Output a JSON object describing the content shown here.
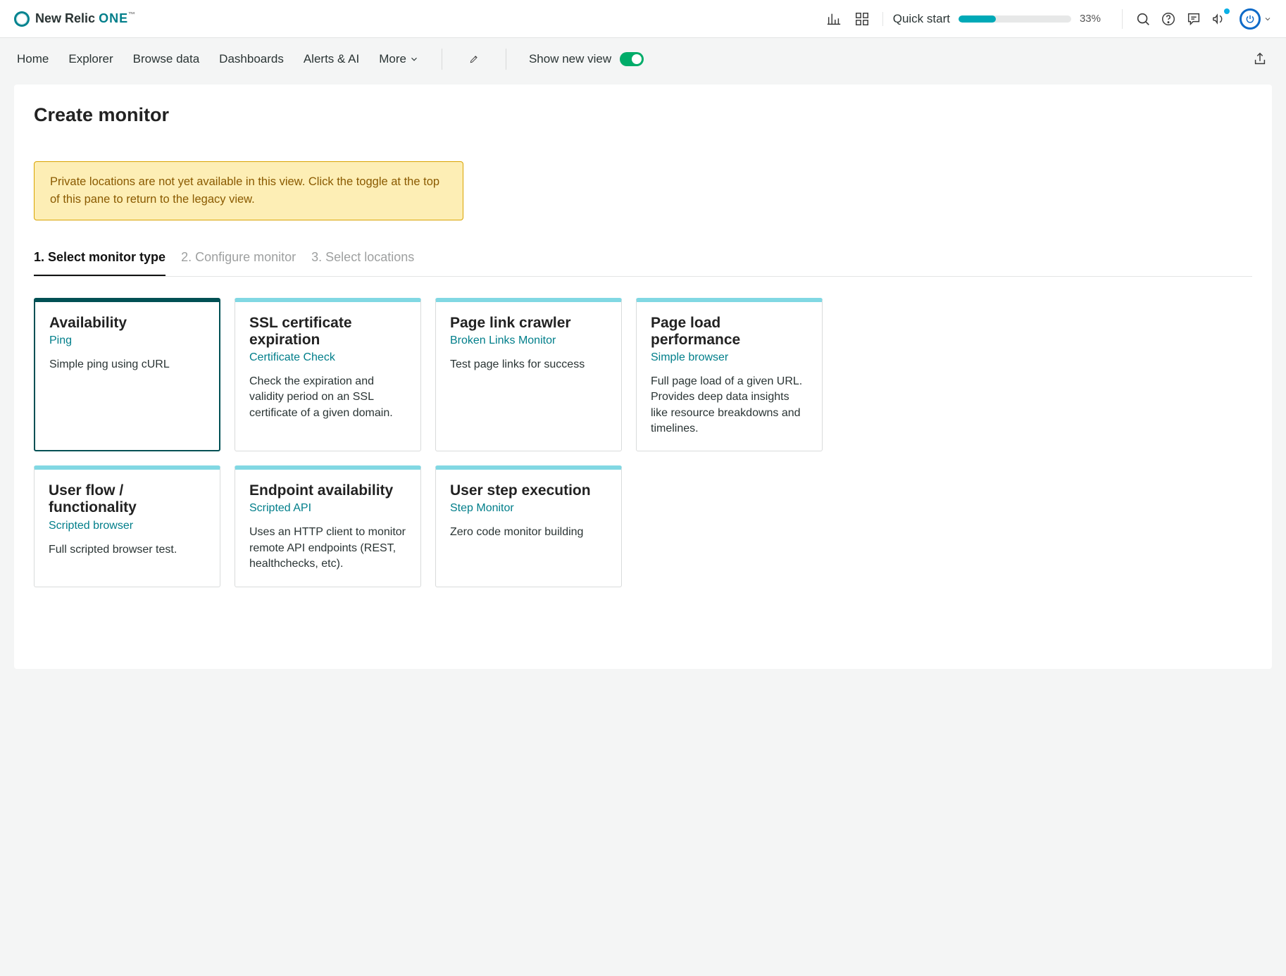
{
  "brand": {
    "name": "New Relic",
    "suffix": "ONE",
    "tm": "™"
  },
  "header": {
    "quick_start_label": "Quick start",
    "progress_percent": "33%"
  },
  "nav": {
    "items": [
      "Home",
      "Explorer",
      "Browse data",
      "Dashboards",
      "Alerts & AI",
      "More"
    ],
    "show_new_view": "Show new view"
  },
  "page": {
    "title": "Create monitor",
    "banner": "Private locations are not yet available in this view.  Click the toggle at the top of this pane to return to the legacy view."
  },
  "steps": [
    {
      "label": "1. Select monitor type",
      "active": true
    },
    {
      "label": "2. Configure monitor",
      "active": false
    },
    {
      "label": "3. Select locations",
      "active": false
    }
  ],
  "cards": [
    {
      "title": "Availability",
      "subtitle": "Ping",
      "desc": "Simple ping using cURL",
      "selected": true
    },
    {
      "title": "SSL certificate expiration",
      "subtitle": "Certificate Check",
      "desc": "Check the expiration and validity period on an SSL certificate of a given domain.",
      "selected": false
    },
    {
      "title": "Page link crawler",
      "subtitle": "Broken Links Monitor",
      "desc": "Test page links for success",
      "selected": false
    },
    {
      "title": "Page load performance",
      "subtitle": "Simple browser",
      "desc": "Full page load of a given URL. Provides deep data insights like resource breakdowns and timelines.",
      "selected": false
    },
    {
      "title": "User flow / functionality",
      "subtitle": "Scripted browser",
      "desc": "Full scripted browser test.",
      "selected": false
    },
    {
      "title": "Endpoint availability",
      "subtitle": "Scripted API",
      "desc": "Uses an HTTP client to monitor remote API endpoints (REST, healthchecks, etc).",
      "selected": false
    },
    {
      "title": "User step execution",
      "subtitle": "Step Monitor",
      "desc": "Zero code monitor building",
      "selected": false
    }
  ],
  "colors": {
    "accent": "#007e8a",
    "card_top": "#81d8e3",
    "selected": "#005054",
    "banner_border": "#d9a300"
  }
}
